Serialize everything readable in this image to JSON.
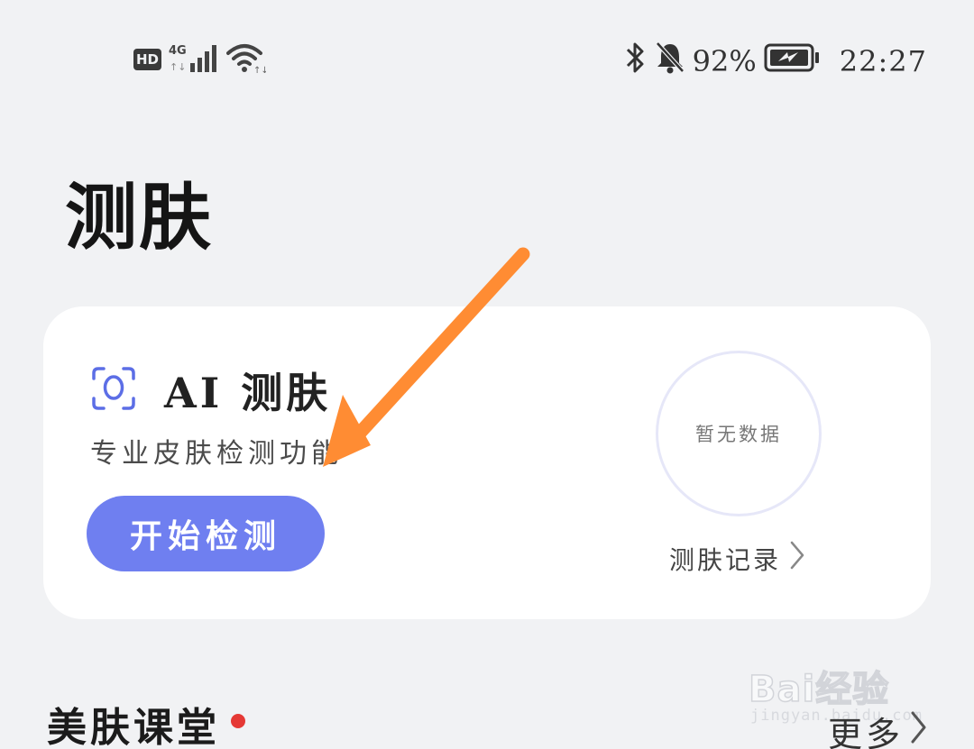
{
  "status_bar": {
    "hd_label": "HD",
    "network_label": "4G",
    "battery_percent": "92%",
    "time": "22:27",
    "icons": [
      "signal-bars-icon",
      "wifi-icon",
      "bluetooth-icon",
      "bell-muted-icon",
      "battery-charging-icon"
    ]
  },
  "page": {
    "title": "测肤"
  },
  "ai_card": {
    "icon": "face-scan-icon",
    "title": "AI 测肤",
    "subtitle": "专业皮肤检测功能",
    "start_button_label": "开始检测",
    "no_data_text": "暂无数据",
    "history_link_label": "测肤记录"
  },
  "section": {
    "title": "美肤课堂",
    "more_label": "更多"
  },
  "annotation": {
    "arrow_color": "#ff8c33"
  },
  "watermark": {
    "text": "Bai经验",
    "sub": "jingyan.baidu.com"
  },
  "colors": {
    "background": "#f1f2f4",
    "card": "#ffffff",
    "accent": "#6f7ff0",
    "red_dot": "#e53935"
  }
}
